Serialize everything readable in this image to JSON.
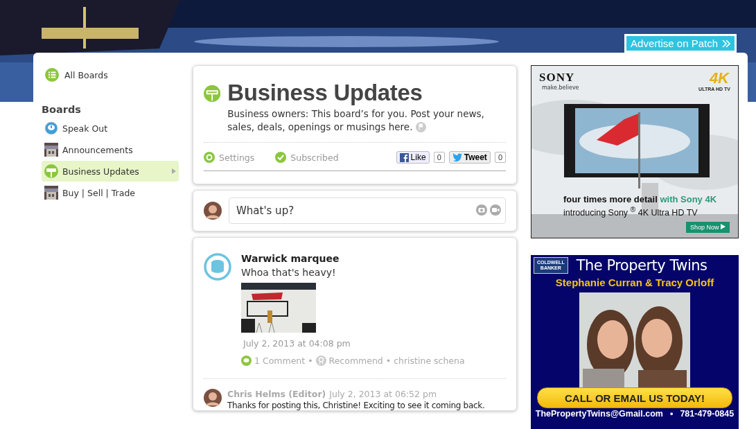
{
  "banner": {
    "advertise_link": "Advertise on Patch"
  },
  "sidebar": {
    "all_boards": "All Boards",
    "heading": "Boards",
    "items": [
      {
        "label": "Speak Out",
        "kind": "bubble",
        "selected": false
      },
      {
        "label": "Announcements",
        "selected": false
      },
      {
        "label": "Business Updates",
        "kind": "sign",
        "selected": true
      },
      {
        "label": "Buy | Sell | Trade",
        "selected": false
      }
    ]
  },
  "board": {
    "title": "Business Updates",
    "description": "Business owners: This board’s for you. Post your news, sales, deals, openings or musings here.",
    "settings": "Settings",
    "subscribed": "Subscribed",
    "like": {
      "label": "Like",
      "count": "0"
    },
    "tweet": {
      "label": "Tweet",
      "count": "0"
    }
  },
  "composer": {
    "placeholder": "What's up?"
  },
  "post": {
    "title": "Warwick marquee",
    "body": "Whoa that's heavy!",
    "timestamp": "July 2, 2013 at 04:08 pm",
    "comments": "1 Comment",
    "recommend": "Recommend",
    "separator": "•",
    "author": "christine schena"
  },
  "comment": {
    "author": "Chris Helms (Editor)",
    "timestamp": "July 2, 2013 at 06:52 pm",
    "body": "Thanks for posting this, Christine! Exciting to see it coming back."
  },
  "ads": {
    "sony": {
      "brand": "SONY",
      "tagline": "make.believe",
      "badge": "4K",
      "badge_sub": "ULTRA HD TV",
      "headline": "four times more detail ",
      "headline_accent": "with Sony 4K",
      "subline": "introducing Sony $^{®}$ 4K Ultra HD TV",
      "cta": "Shop Now"
    },
    "property": {
      "logo_top": "COLDWELL",
      "logo_bottom": "BANKER",
      "title": "The Property Twins",
      "names": "Stephanie Curran & Tracy Orloff",
      "cta": "CALL OR EMAIL US TODAY!",
      "email": "ThePropertyTwins@Gmail.com",
      "separator": "•",
      "phone": "781-479-0845"
    }
  }
}
